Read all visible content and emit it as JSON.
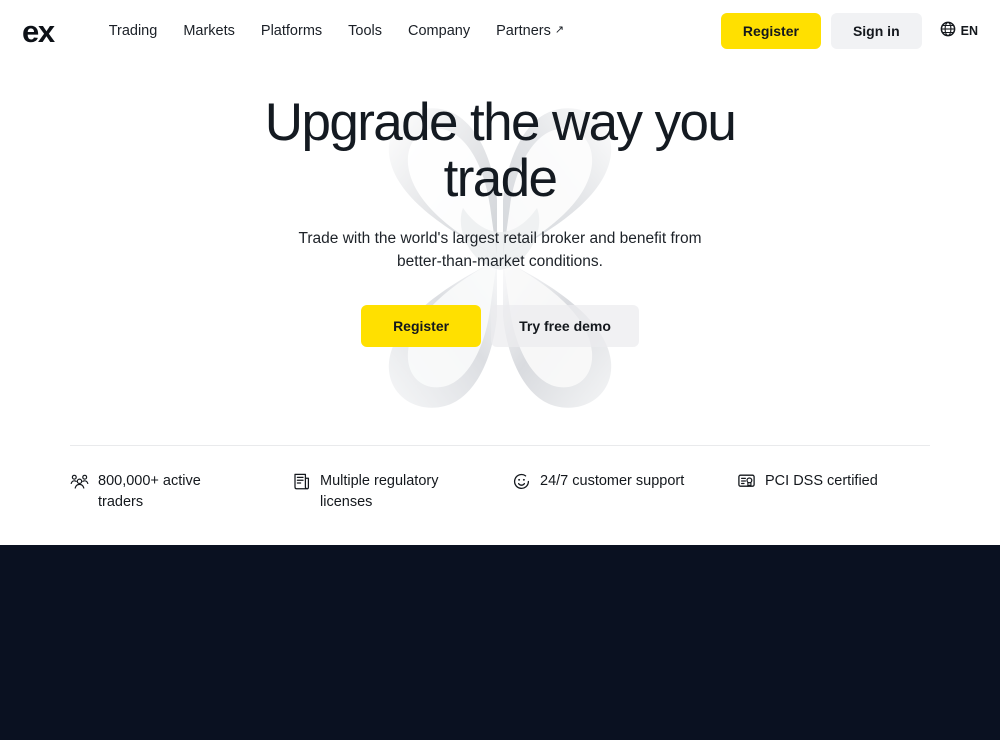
{
  "header": {
    "logo": "ex",
    "nav": [
      {
        "label": "Trading",
        "external": false
      },
      {
        "label": "Markets",
        "external": false
      },
      {
        "label": "Platforms",
        "external": false
      },
      {
        "label": "Tools",
        "external": false
      },
      {
        "label": "Company",
        "external": false
      },
      {
        "label": "Partners",
        "external": true,
        "arrow": "↗"
      }
    ],
    "register_label": "Register",
    "signin_label": "Sign in",
    "language": "EN"
  },
  "hero": {
    "title": "Upgrade the way you trade",
    "subtitle": "Trade with the world's largest retail broker and benefit from better-than-market conditions.",
    "primary_cta": "Register",
    "secondary_cta": "Try free demo"
  },
  "features": [
    {
      "icon": "users-group-icon",
      "label": "800,000+ active traders"
    },
    {
      "icon": "scroll-document-icon",
      "label": "Multiple regulatory licenses"
    },
    {
      "icon": "smiley-face-icon",
      "label": "24/7 customer support"
    },
    {
      "icon": "certificate-badge-icon",
      "label": "PCI DSS certified"
    }
  ],
  "colors": {
    "brand_yellow": "#FFE000",
    "text_dark": "#14181d",
    "dark_section": "#0A1121",
    "button_grey": "#f1f2f4",
    "divider": "#e9eaec"
  }
}
